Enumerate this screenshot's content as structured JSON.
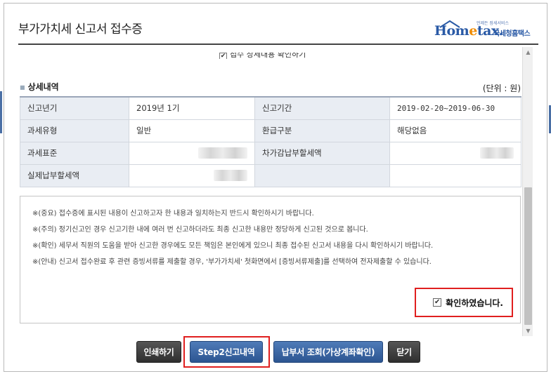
{
  "dialog": {
    "title": "부가가치세 신고서 접수증"
  },
  "logo": {
    "small_text": "언제든 잠세서비스",
    "main_prefix": "Hom",
    "main_e": "e",
    "main_suffix": "tax.",
    "korean": "국세청홈택스"
  },
  "cut_row": {
    "text": "접수 상세내용 확인하기"
  },
  "detail": {
    "section_title": "상세내역",
    "unit": "(단위 : 원)",
    "rows": [
      [
        "신고년기",
        "2019년 1기",
        "신고기간",
        "2019-02-20~2019-06-30"
      ],
      [
        "과세유형",
        "일반",
        "환급구분",
        "해당없음"
      ],
      [
        "과세표준",
        "",
        "차가감납부할세액",
        ""
      ],
      [
        "실제납부할세액",
        "",
        "",
        ""
      ]
    ]
  },
  "notices": [
    "※(중요) 접수증에 표시된 내용이 신고하고자 한 내용과 일치하는지 반드시 확인하시기 바랍니다.",
    "※(주의) 정기신고인 경우 신고기한 내에 여러 번 신고하더라도 최종 신고한 내용만 정당하게 신고된 것으로 봅니다.",
    "※(확인) 세무서 직원의 도움을 받아 신고한 경우에도 모든 책임은 본인에게 있으니 최종 접수된 신고서 내용을 다시 확인하시기 바랍니다.",
    "※(안내) 신고서 접수완료 후 관련 증빙서류를 제출할 경우, '부가가치세' 첫화면에서 [증빙서류제출]를 선택하여 전자제출할 수 있습니다."
  ],
  "confirm": {
    "label": "확인하였습니다.",
    "checked": true
  },
  "buttons": {
    "print": "인쇄하기",
    "step2": "Step2신고내역",
    "payment": "납부서 조회(가상계좌확인)",
    "close": "닫기"
  },
  "colors": {
    "highlight": "#e01f1f",
    "button_dark": "#3a3a3a",
    "button_blue": "#3a67a6",
    "label_bg": "#e9edf3"
  }
}
